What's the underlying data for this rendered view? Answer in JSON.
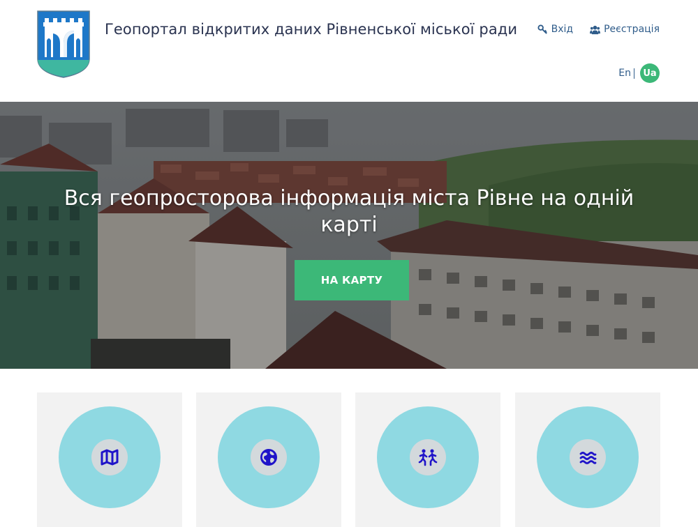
{
  "header": {
    "site_title": "Геопортал відкритих даних Рівненської міської ради",
    "login_label": "Вхід",
    "register_label": "Реєстрація",
    "lang_en": "En",
    "lang_ua": "Ua"
  },
  "hero": {
    "title": "Вся геопросторова інформація міста Рівне на одній карті",
    "button_label": "НА КАРТУ"
  },
  "cards": [
    {
      "icon": "map-icon"
    },
    {
      "icon": "globe-icon"
    },
    {
      "icon": "people-running-icon"
    },
    {
      "icon": "water-icon"
    }
  ],
  "colors": {
    "accent_green": "#3cb878",
    "circle_blue": "#8fd9e2",
    "icon_blue": "#1f14c9",
    "title_dark": "#2a3350",
    "link_blue": "#2f5c8a"
  }
}
